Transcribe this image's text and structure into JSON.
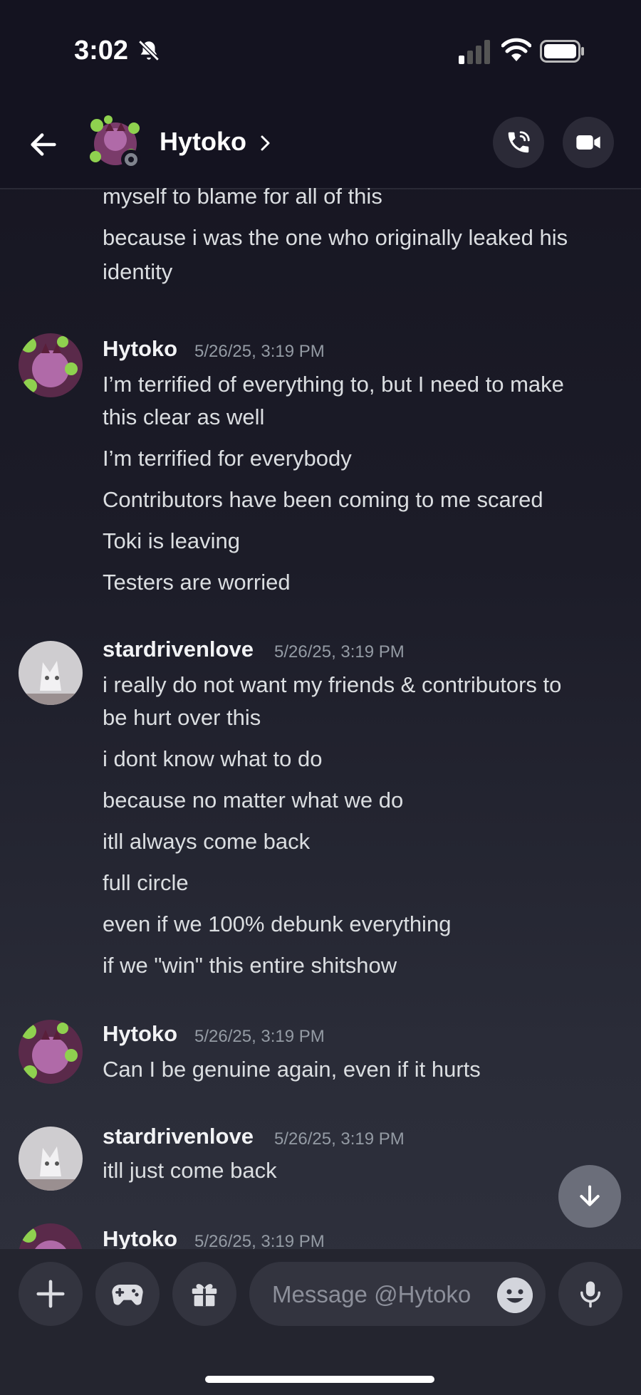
{
  "status_bar": {
    "time": "3:02"
  },
  "header": {
    "contact_name": "Hytoko"
  },
  "messages": {
    "cont_lines": [
      "myself to blame for all of this",
      "because i was the one who originally leaked his",
      "identity"
    ],
    "g1": {
      "author": "Hytoko",
      "timestamp": "5/26/25, 3:19 PM",
      "lines": [
        "I’m terrified of everything to, but I need to make",
        "this clear as well",
        "I’m terrified for everybody",
        "Contributors have been coming to me scared",
        "Toki is leaving",
        "Testers are worried"
      ]
    },
    "g2": {
      "author": "stardrivenlove",
      "timestamp": "5/26/25, 3:19 PM",
      "lines": [
        "i really do not want my friends & contributors to",
        "be hurt over this",
        "i dont know what to do",
        "because no matter what we do",
        "itll always come back",
        "full circle",
        "even if we 100% debunk everything",
        "if we \"win\" this entire shitshow"
      ]
    },
    "g3": {
      "author": "Hytoko",
      "timestamp": "5/26/25, 3:19 PM",
      "lines": [
        "Can I be genuine again, even if it hurts"
      ]
    },
    "g4": {
      "author": "stardrivenlove",
      "timestamp": "5/26/25, 3:19 PM",
      "lines": [
        "itll just come back"
      ]
    },
    "g5": {
      "author": "Hytoko",
      "timestamp": "5/26/25, 3:19 PM"
    }
  },
  "composer": {
    "placeholder": "Message @Hytoko"
  },
  "colors": {
    "background": "#1c1c28",
    "header": "#141320",
    "composer": "#24252f",
    "button": "#33343f"
  }
}
